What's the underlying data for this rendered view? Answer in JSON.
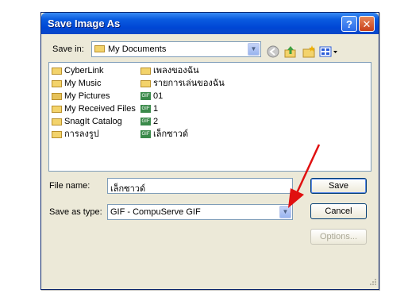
{
  "dialog": {
    "title": "Save Image As",
    "help_symbol": "?",
    "close_symbol": "✕"
  },
  "toolbar": {
    "save_in_label": "Save in:",
    "location": "My Documents",
    "location_icon": "folder-icon",
    "icons": [
      "back-icon",
      "up-folder-icon",
      "new-folder-icon",
      "views-menu-icon"
    ]
  },
  "files": {
    "column1": [
      {
        "name": "CyberLink",
        "icon": "folder-icon"
      },
      {
        "name": "My Music",
        "icon": "music-folder-icon"
      },
      {
        "name": "My Pictures",
        "icon": "pictures-folder-icon"
      },
      {
        "name": "My Received Files",
        "icon": "folder-icon"
      },
      {
        "name": "SnagIt Catalog",
        "icon": "folder-icon"
      },
      {
        "name": "การลงรูป",
        "icon": "folder-icon"
      }
    ],
    "column2": [
      {
        "name": "เพลงของฉัน",
        "icon": "folder-icon"
      },
      {
        "name": "รายการเล่นของฉัน",
        "icon": "folder-icon"
      },
      {
        "name": "01",
        "icon": "gif-file-icon"
      },
      {
        "name": "1",
        "icon": "gif-file-icon"
      },
      {
        "name": "2",
        "icon": "gif-file-icon"
      },
      {
        "name": "เล็กซาวด์",
        "icon": "gif-file-icon"
      }
    ],
    "gif_badge": "GIF"
  },
  "form": {
    "file_name_label": "File name:",
    "file_name_value": "เล็กซาวด์",
    "save_as_type_label": "Save as type:",
    "save_as_type_value": "GIF - CompuServe GIF"
  },
  "buttons": {
    "save": "Save",
    "cancel": "Cancel",
    "options": "Options..."
  },
  "colors": {
    "titlebar": "#0046d5",
    "dialog_bg": "#ece9d8",
    "annotation_arrow": "#e01010"
  }
}
